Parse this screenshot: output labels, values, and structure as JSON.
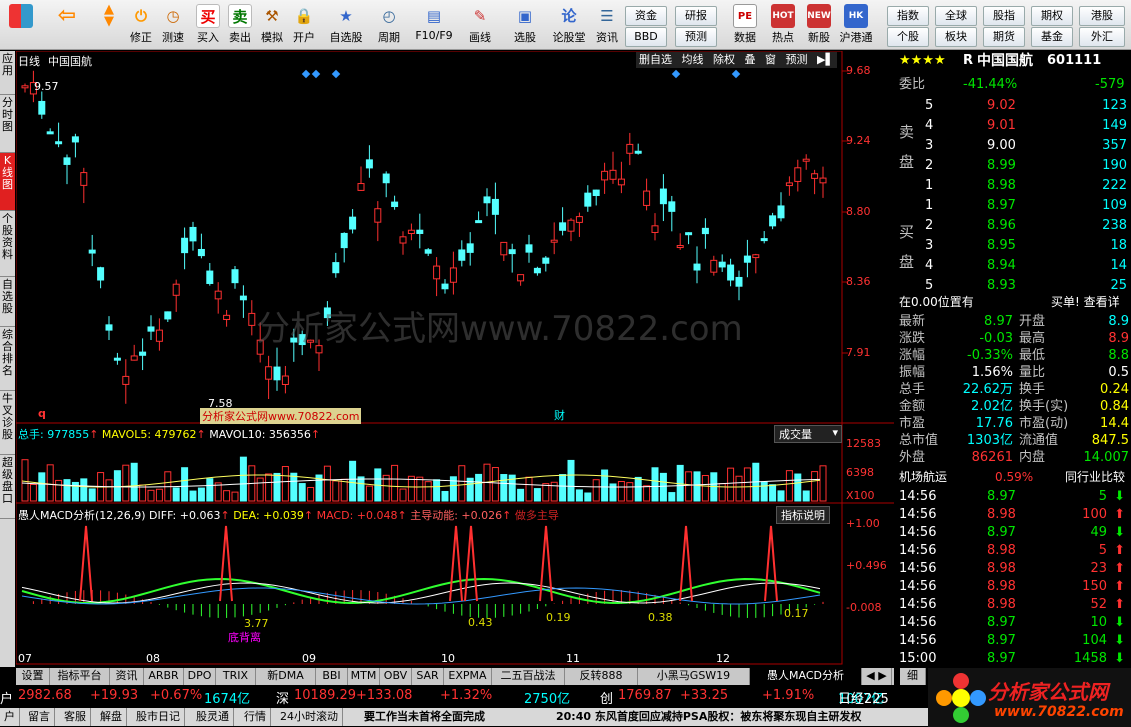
{
  "toolbar": {
    "buttons": [
      "",
      "",
      "修正",
      "测速",
      "买入",
      "卖出",
      "模拟",
      "开户",
      "自选股",
      "周期",
      "F10/F9",
      "画线",
      "选股",
      "论股堂",
      "资讯",
      "",
      "",
      "",
      "数据",
      "热点",
      "新股",
      "沪港通"
    ],
    "left_group": [
      "资金",
      "研报",
      "BBD",
      "预测"
    ],
    "right_group": [
      "指数",
      "全球",
      "股指",
      "期权",
      "港股",
      "个股",
      "板块",
      "期货",
      "基金",
      "外汇"
    ]
  },
  "left_tabs": [
    "应用",
    "分时图",
    "K线图",
    "个股资料",
    "自选股",
    "综合排名",
    "牛叉诊股",
    "超级盘口"
  ],
  "chart": {
    "period": "日线",
    "name": "中国国航",
    "watermark": "分析家公式网www.70822.com",
    "menu": [
      "删自选",
      "均线",
      "除权",
      "叠",
      "窗",
      "预测"
    ],
    "prices": [
      "9.68",
      "9.24",
      "8.80",
      "8.36",
      "7.91"
    ],
    "hi_label": "9.57",
    "lo_label": "7.58",
    "marks": [
      "q",
      "财"
    ],
    "vol": {
      "total_label": "总手: 977855",
      "mavol5": "MAVOL5: 479762",
      "mavol10": "MAVOL10: 356356",
      "dropdown": "成交量",
      "scale": [
        "12583",
        "6398",
        "X100"
      ]
    },
    "macd": {
      "title": "愚人MACD分析(12,26,9)",
      "diff": "DIFF: +0.063",
      "dea": "DEA: +0.039",
      "macd": "MACD: +0.048",
      "zd": "主导动能: +0.026",
      "extra": "做多主导",
      "btn": "指标说明",
      "scale": [
        "+1.00",
        "+0.496",
        "-0.008"
      ],
      "ann": [
        "3.77",
        "0.43",
        "0.19",
        "0.19",
        "0.38",
        "0.17",
        "底背离"
      ]
    },
    "months": [
      "07",
      "08",
      "09",
      "10",
      "11",
      "12"
    ]
  },
  "quote": {
    "stars": "★★★★",
    "r": "R",
    "name": "中国国航",
    "code": "601111",
    "weibi_label": "委比",
    "weibi": "-41.44%",
    "weibi2": "-579",
    "sell_label": "卖盘",
    "buy_label": "买盘",
    "sells": [
      [
        "5",
        "9.02",
        "123"
      ],
      [
        "4",
        "9.01",
        "149"
      ],
      [
        "3",
        "9.00",
        "357"
      ],
      [
        "2",
        "8.99",
        "190"
      ],
      [
        "1",
        "8.98",
        "222"
      ]
    ],
    "buys": [
      [
        "1",
        "8.97",
        "109"
      ],
      [
        "2",
        "8.96",
        "238"
      ],
      [
        "3",
        "8.95",
        "18"
      ],
      [
        "4",
        "8.94",
        "14"
      ],
      [
        "5",
        "8.93",
        "25"
      ]
    ],
    "pos_text": "在0.00位置有",
    "pos_right": "买单! 查看详",
    "stats": [
      [
        "最新",
        "8.97",
        "开盘",
        "8.9"
      ],
      [
        "涨跌",
        "-0.03",
        "最高",
        "8.9"
      ],
      [
        "涨幅",
        "-0.33%",
        "最低",
        "8.8"
      ],
      [
        "振幅",
        "1.56%",
        "量比",
        "0.5"
      ],
      [
        "总手",
        "22.62万",
        "换手",
        "0.24"
      ],
      [
        "金额",
        "2.02亿",
        "换手(实)",
        "0.84"
      ],
      [
        "市盈",
        "17.76",
        "市盈(动)",
        "14.4"
      ],
      [
        "总市值",
        "1303亿",
        "流通值",
        "847.5"
      ],
      [
        "外盘",
        "86261",
        "内盘",
        "14.007"
      ]
    ],
    "industry": "机场航运",
    "industry_pct": "0.59%",
    "compare": "同行业比较",
    "ticks": [
      [
        "14:56",
        "8.97",
        "5",
        "dn"
      ],
      [
        "14:56",
        "8.98",
        "100",
        "up"
      ],
      [
        "14:56",
        "8.97",
        "49",
        "dn"
      ],
      [
        "14:56",
        "8.98",
        "5",
        "up"
      ],
      [
        "14:56",
        "8.98",
        "23",
        "up"
      ],
      [
        "14:56",
        "8.98",
        "150",
        "up"
      ],
      [
        "14:56",
        "8.98",
        "52",
        "up"
      ],
      [
        "14:56",
        "8.97",
        "10",
        "dn"
      ],
      [
        "14:56",
        "8.97",
        "104",
        "dn"
      ],
      [
        "15:00",
        "8.97",
        "1458",
        "dn"
      ]
    ]
  },
  "bottom_tabs": [
    "设置",
    "指标平台",
    "资讯",
    "ARBR",
    "DPO",
    "TRIX",
    "新DMA",
    "BBI",
    "MTM",
    "OBV",
    "SAR",
    "EXPMA",
    "二五百战法",
    "反转888",
    "小黑马GSW19",
    "愚人MACD分析"
  ],
  "bottom_right": [
    "细"
  ],
  "status": {
    "row1": [
      [
        "户",
        "2982.68",
        "+19.93",
        "+0.67%",
        "1674亿"
      ],
      [
        "深",
        "10189.29",
        "+133.08",
        "+1.32%",
        "2750亿"
      ],
      [
        "创",
        "1769.87",
        "+33.25",
        "+1.91%",
        "1007亿"
      ]
    ],
    "row1_tail": "日经225",
    "row2": [
      "户",
      "留言",
      "客服",
      "解盘",
      "股市日记",
      "股灵通",
      "行情",
      "24小时滚动"
    ],
    "news": "要工作当未首将全面完成",
    "news2": "20:40 东风首度回应减持PSA股权：被东将聚东现自主研发权"
  },
  "logo": "分析家公式网",
  "logo_url": "www.70822.com"
}
